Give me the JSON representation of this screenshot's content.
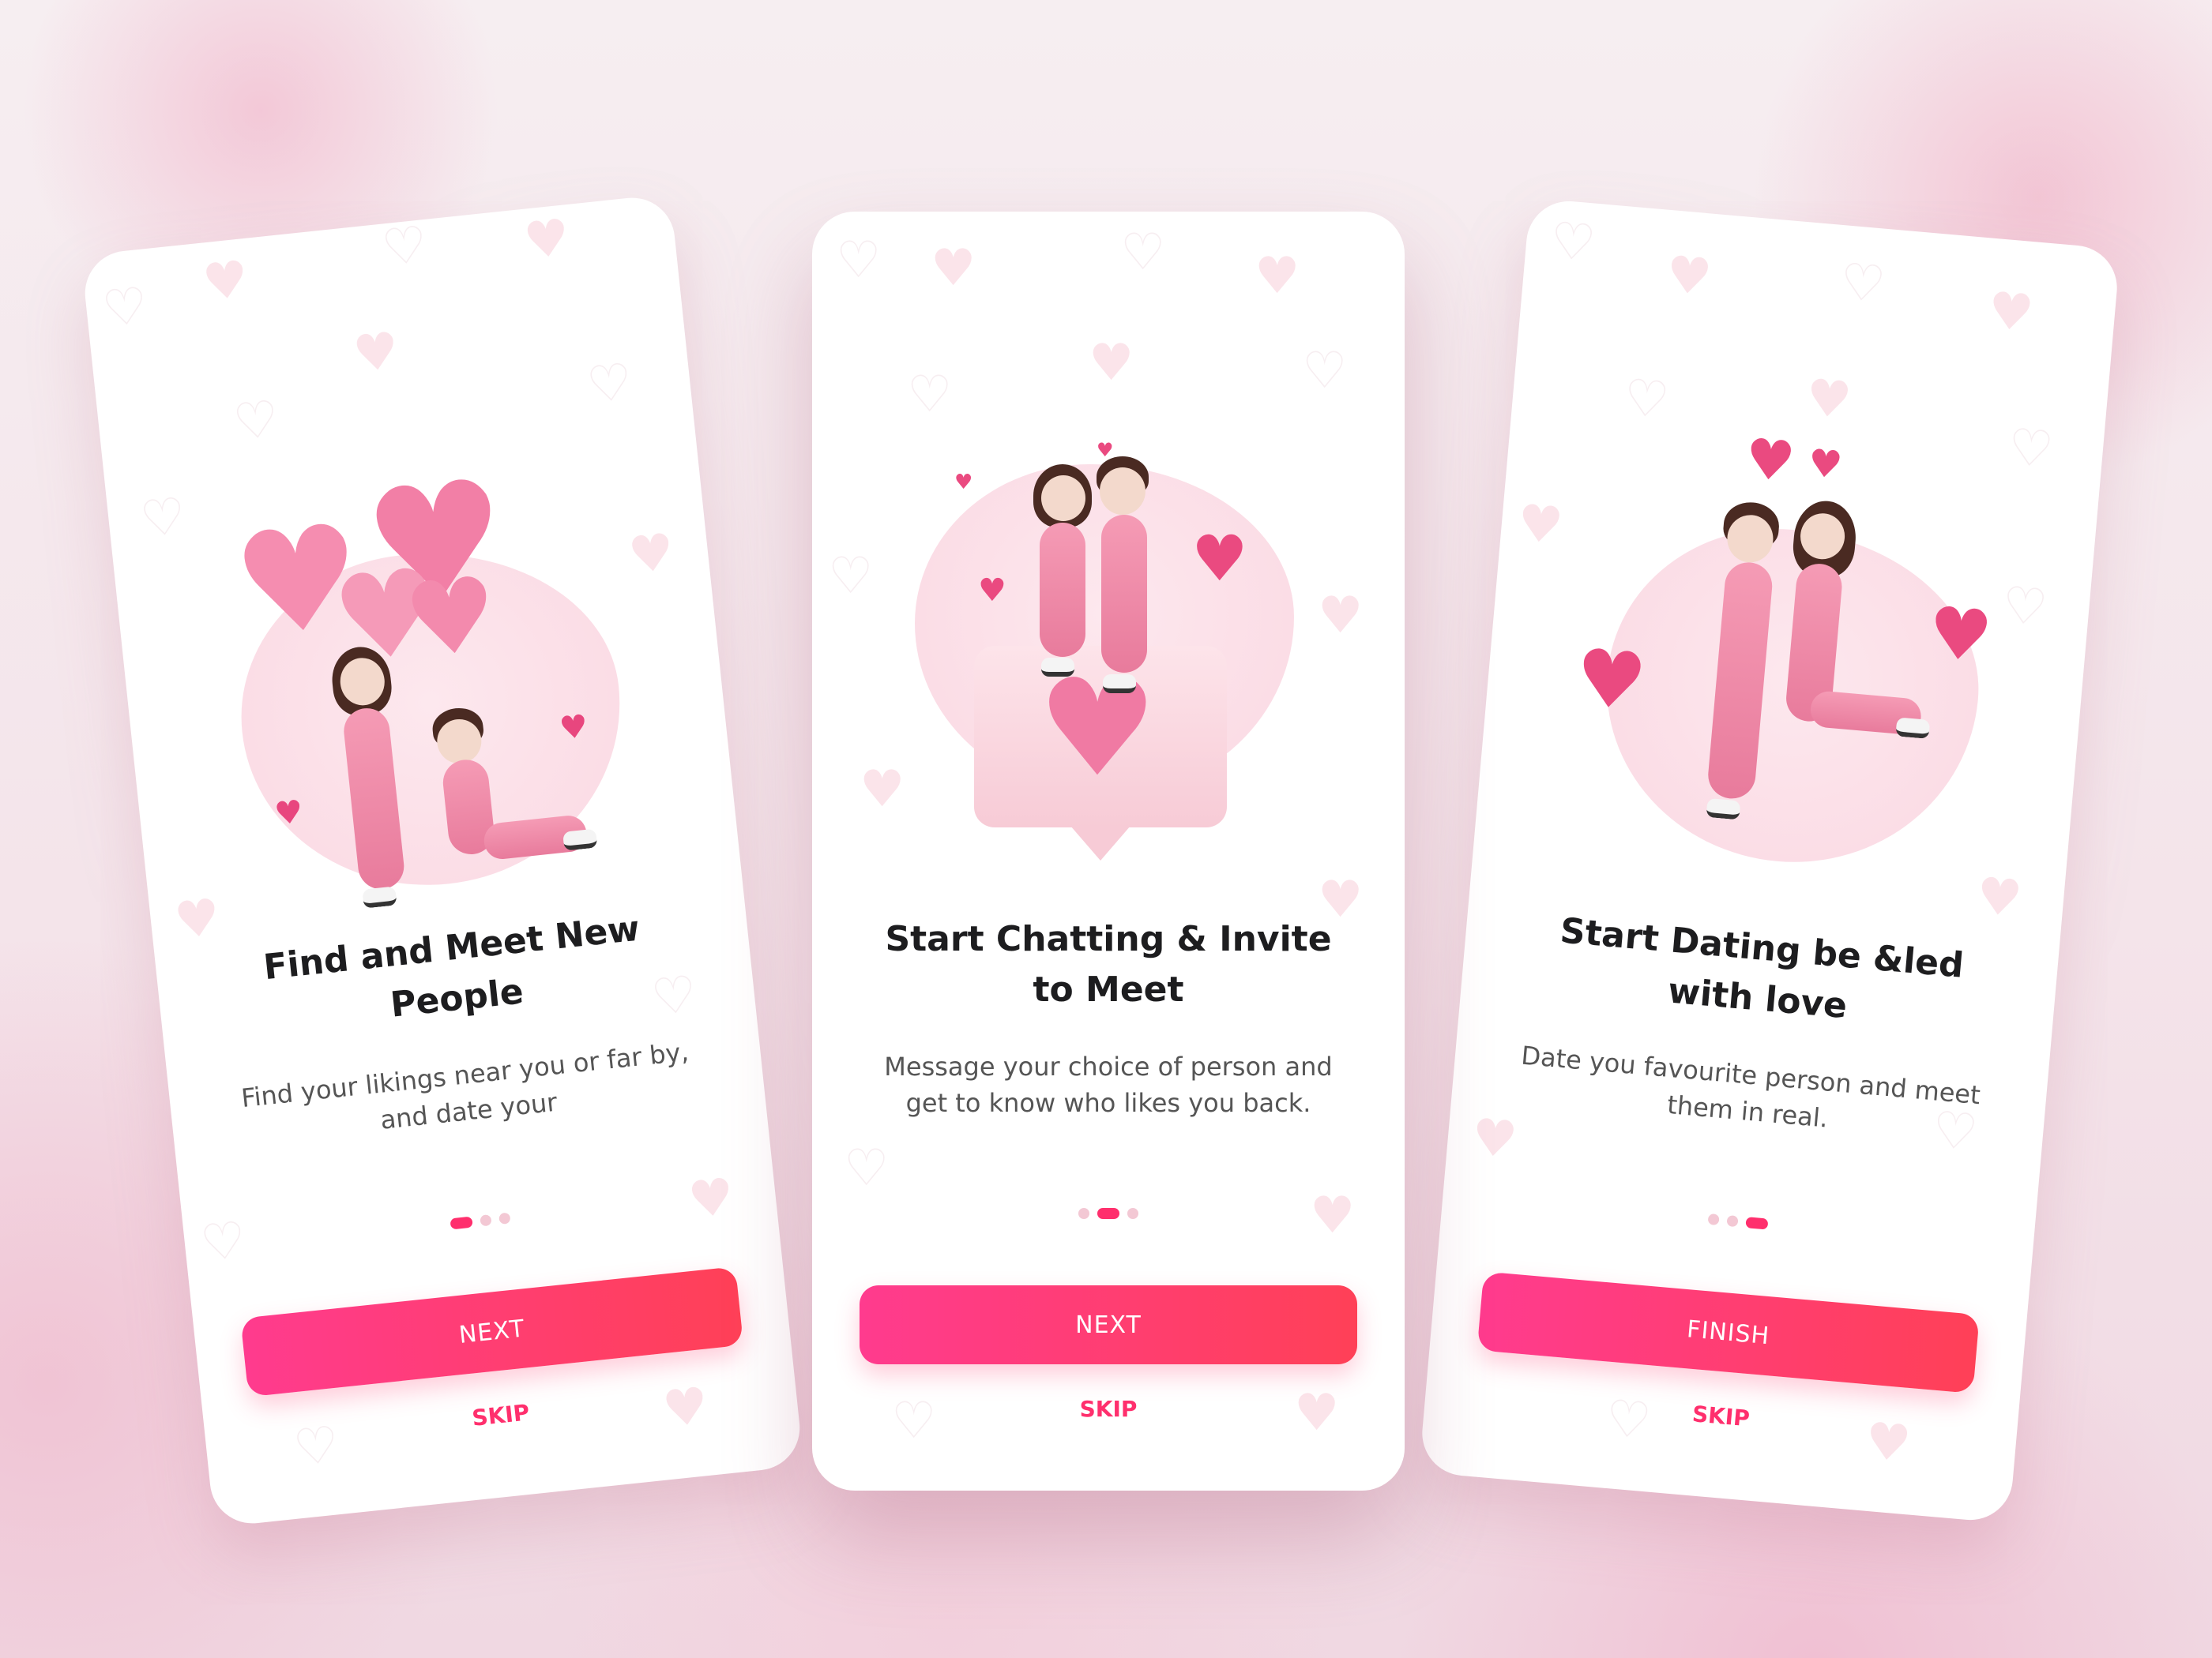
{
  "screens": [
    {
      "title": "Find and Meet New People",
      "description": "Find your likings near you or far by, and date your",
      "button_label": "NEXT",
      "skip_label": "SKIP",
      "active_dot": 0
    },
    {
      "title": "Start Chatting & Invite to Meet",
      "description": "Message your choice of person and get to know who likes you back.",
      "button_label": "NEXT",
      "skip_label": "SKIP",
      "active_dot": 1
    },
    {
      "title": "Start Dating be &led with love",
      "description": "Date you favourite person and meet them in real.",
      "button_label": "FINISH",
      "skip_label": "SKIP",
      "active_dot": 2
    }
  ],
  "colors": {
    "accent_start": "#ff3b8e",
    "accent_end": "#ff4057",
    "skip_text": "#ff2f6d",
    "dot_inactive": "#f3c8d4"
  },
  "icons": [
    "heart-pattern-icon",
    "heart-balloon-icon",
    "chat-bubble-icon"
  ]
}
